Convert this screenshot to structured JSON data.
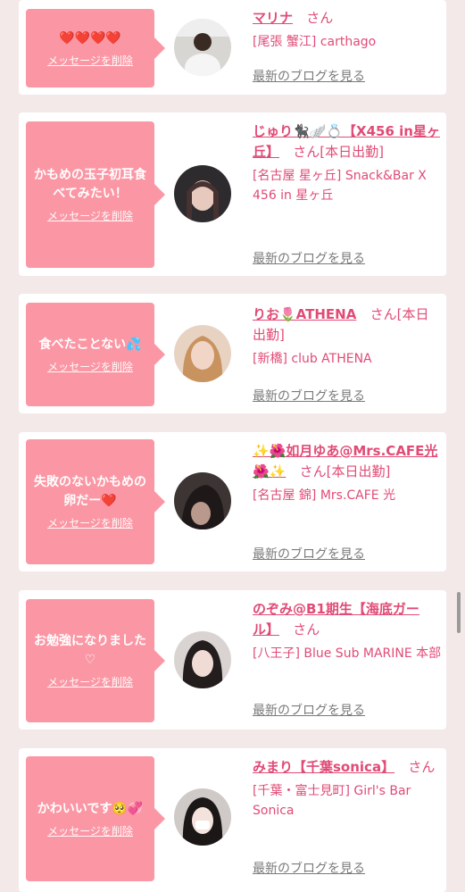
{
  "delete_label": "メッセージを削除",
  "blog_label": "最新のブログを見る",
  "san": "さん",
  "cards": [
    {
      "message": "❤️❤️❤️❤️",
      "name": "マリナ",
      "status": "",
      "shop": "[尾張 蟹江] carthago"
    },
    {
      "message": "かもめの玉子初耳食べてみたい！",
      "name": "じゅり🐈‍⬛🪽💍【X456 in星ヶ丘】",
      "status": "[本日出勤]",
      "shop": "[名古屋 星ヶ丘] Snack&Bar X 456 in 星ヶ丘"
    },
    {
      "message": "食べたことない💦",
      "name": "りお🌷ATHENA",
      "status": "[本日出勤]",
      "shop": "[新橋] club ATHENA"
    },
    {
      "message": "失敗のないかもめの卵だー❤️",
      "name": "✨🌺如月ゆあ@Mrs.CAFE光🌺✨",
      "status": "[本日出勤]",
      "shop": "[名古屋 錦] Mrs.CAFE 光"
    },
    {
      "message": "お勉強になりました♡",
      "name": "のぞみ@B1期生【海底ガール】",
      "status": "",
      "shop": "[八王子] Blue Sub MARINE 本部"
    },
    {
      "message": "かわいいです🥺💞",
      "name": "みまり【千葉sonica】",
      "status": "",
      "shop": "[千葉・富士見町] Girl's Bar Sonica"
    }
  ]
}
